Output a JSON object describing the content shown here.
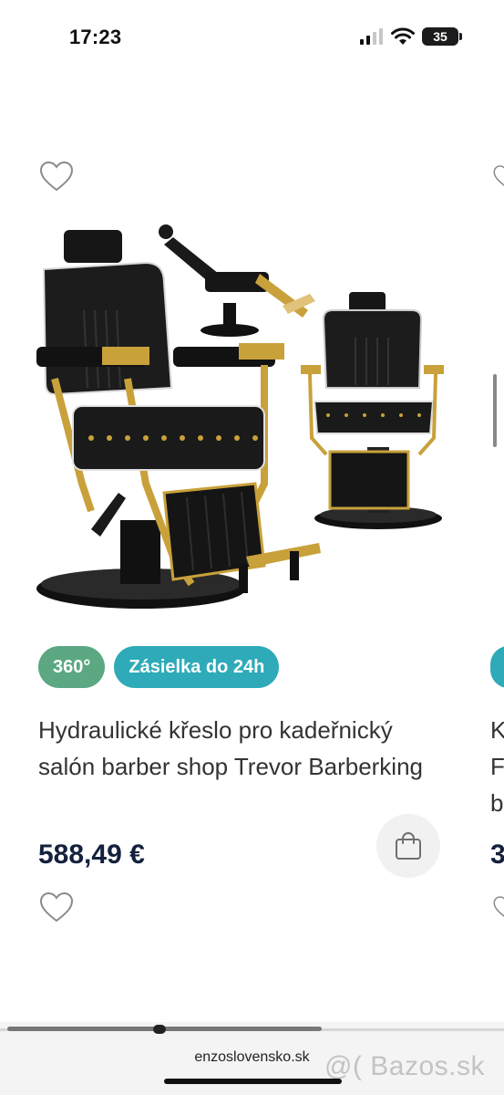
{
  "status_bar": {
    "time": "17:23",
    "battery_level": "35",
    "icons": [
      "signal-icon",
      "wifi-icon",
      "battery-icon"
    ]
  },
  "product": {
    "badges": [
      {
        "label": "360°",
        "color": "#5ba882"
      },
      {
        "label": "Zásielka do 24h",
        "color": "#2eaab8"
      }
    ],
    "title": "Hydraulické křeslo pro kadeřnický salón barber shop Trevor Barberking",
    "price": "588,49 €",
    "icons": [
      "heart-icon",
      "shopping-bag-icon"
    ]
  },
  "next_product_partial": {
    "title_lines": [
      "K",
      "F",
      "b"
    ],
    "price": "3"
  },
  "browser": {
    "url": "enzoslovensko.sk"
  },
  "watermark": "@( Bazos.sk",
  "colors": {
    "price_text": "#14213d",
    "badge_360": "#5ba882",
    "badge_shipping": "#2eaab8"
  }
}
